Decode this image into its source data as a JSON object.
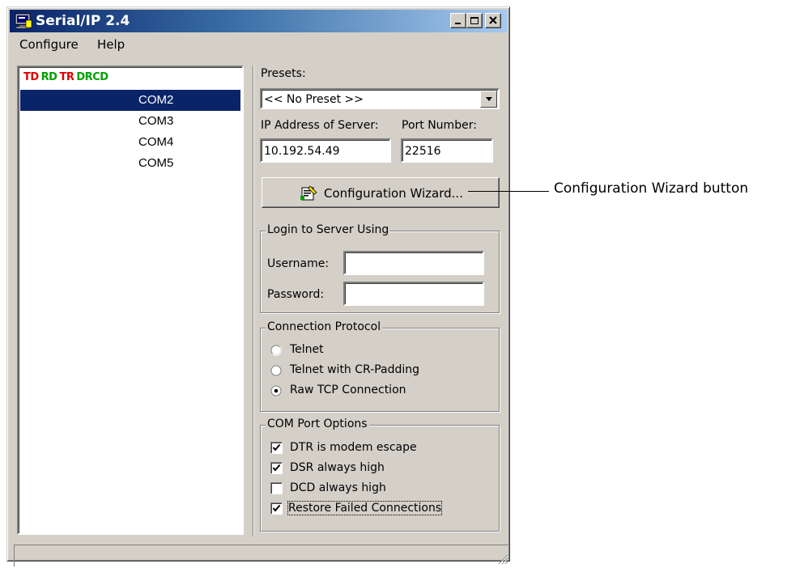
{
  "window": {
    "title": "Serial/IP 2.4",
    "icon": "serial-ip-app-icon",
    "controls": [
      "minimize-icon",
      "maximize-icon",
      "close-icon"
    ]
  },
  "menu": {
    "items": [
      "Configure",
      "Help"
    ]
  },
  "port_list": {
    "signals": [
      {
        "label": "TD",
        "color": "#e00000"
      },
      {
        "label": "RD",
        "color": "#00a000"
      },
      {
        "label": "TR",
        "color": "#e00000"
      },
      {
        "label": "DR",
        "color": "#00a000"
      },
      {
        "label": "CD",
        "color": "#00a000"
      }
    ],
    "ports": [
      {
        "label": "COM2",
        "selected": true
      },
      {
        "label": "COM3",
        "selected": false
      },
      {
        "label": "COM4",
        "selected": false
      },
      {
        "label": "COM5",
        "selected": false
      }
    ]
  },
  "presets": {
    "label": "Presets:",
    "value": "<< No Preset >>"
  },
  "server": {
    "ip_label": "IP Address of Server:",
    "ip_value": "10.192.54.49",
    "port_label": "Port Number:",
    "port_value": "22516"
  },
  "wizard_button": {
    "label": "Configuration Wizard...",
    "icon": "wizard-icon"
  },
  "login": {
    "title": "Login to Server Using",
    "username_label": "Username:",
    "username_value": "",
    "password_label": "Password:",
    "password_value": ""
  },
  "protocol": {
    "title": "Connection Protocol",
    "options": [
      {
        "label": "Telnet",
        "selected": false
      },
      {
        "label": "Telnet with CR-Padding",
        "selected": false
      },
      {
        "label": "Raw TCP Connection",
        "selected": true
      }
    ]
  },
  "com_options": {
    "title": "COM Port Options",
    "options": [
      {
        "label": "DTR is modem escape",
        "checked": true
      },
      {
        "label": "DSR always high",
        "checked": true
      },
      {
        "label": "DCD always high",
        "checked": false
      },
      {
        "label": "Restore Failed Connections",
        "checked": true
      }
    ]
  },
  "status_bar": {
    "text": ""
  },
  "callout": {
    "text": "Configuration Wizard button"
  }
}
